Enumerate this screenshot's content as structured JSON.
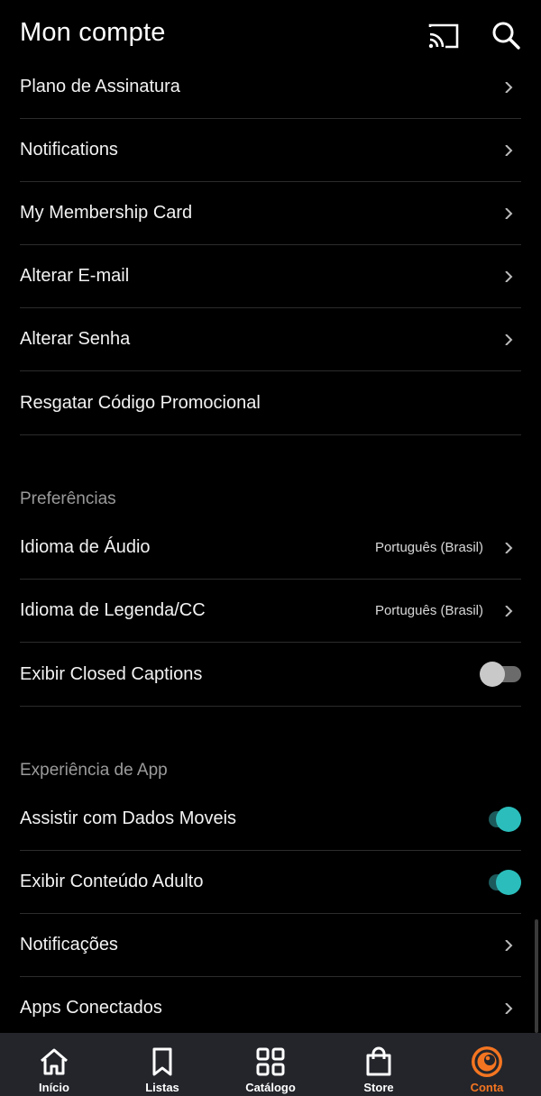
{
  "header": {
    "title": "Mon compte"
  },
  "account_items": [
    {
      "label": "Plano de Assinatura",
      "chevron": true
    },
    {
      "label": "Notifications",
      "chevron": true
    },
    {
      "label": "My Membership Card",
      "chevron": true
    },
    {
      "label": "Alterar E-mail",
      "chevron": true
    },
    {
      "label": "Alterar Senha",
      "chevron": true
    },
    {
      "label": "Resgatar Código Promocional",
      "chevron": false
    }
  ],
  "preferences": {
    "heading": "Preferências",
    "audio_language": {
      "label": "Idioma de Áudio",
      "value": "Português (Brasil)"
    },
    "subtitle_language": {
      "label": "Idioma de Legenda/CC",
      "value": "Português (Brasil)"
    },
    "closed_captions": {
      "label": "Exibir Closed Captions",
      "enabled": false
    }
  },
  "app_experience": {
    "heading": "Experiência de App",
    "mobile_data": {
      "label": "Assistir com Dados Moveis",
      "enabled": true
    },
    "adult_content": {
      "label": "Exibir Conteúdo Adulto",
      "enabled": true
    },
    "notifications": {
      "label": "Notificações"
    },
    "connected_apps": {
      "label": "Apps Conectados"
    }
  },
  "bottom_nav": {
    "items": [
      {
        "label": "Início",
        "icon": "home-icon"
      },
      {
        "label": "Listas",
        "icon": "bookmark-icon"
      },
      {
        "label": "Catálogo",
        "icon": "grid-icon"
      },
      {
        "label": "Store",
        "icon": "shopping-bag-icon"
      },
      {
        "label": "Conta",
        "icon": "crunchyroll-logo-icon"
      }
    ],
    "active_index": 4
  },
  "colors": {
    "background": "#000000",
    "nav_background": "#23252b",
    "accent": "#f47521",
    "toggle_on": "#2abdbb",
    "section_heading": "#9a9a9a"
  }
}
